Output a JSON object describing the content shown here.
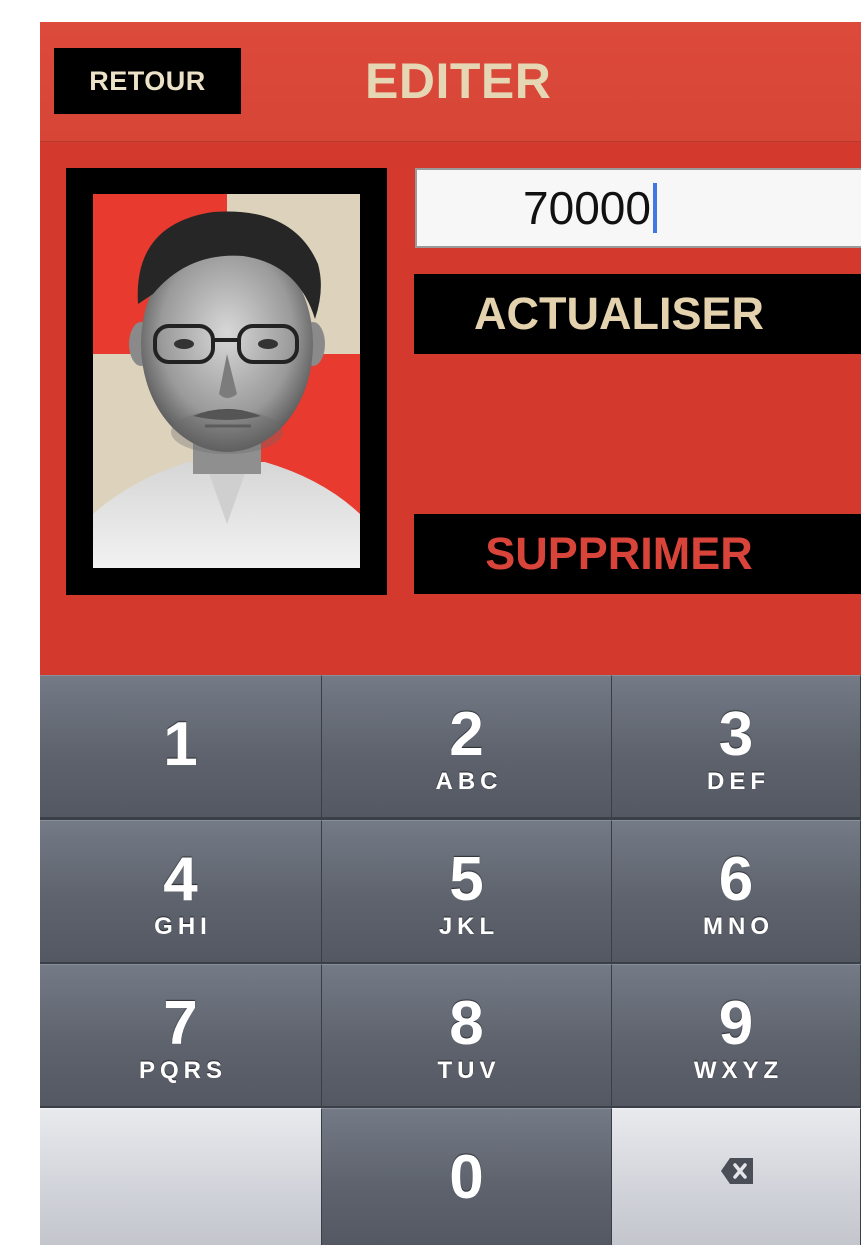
{
  "header": {
    "back_label": "RETOUR",
    "title": "EDITER"
  },
  "form": {
    "amount_value": "70000",
    "update_label": "ACTUALISER",
    "delete_label": "SUPPRIMER"
  },
  "keypad": {
    "keys": [
      {
        "digit": "1",
        "letters": ""
      },
      {
        "digit": "2",
        "letters": "ABC"
      },
      {
        "digit": "3",
        "letters": "DEF"
      },
      {
        "digit": "4",
        "letters": "GHI"
      },
      {
        "digit": "5",
        "letters": "JKL"
      },
      {
        "digit": "6",
        "letters": "MNO"
      },
      {
        "digit": "7",
        "letters": "PQRS"
      },
      {
        "digit": "8",
        "letters": "TUV"
      },
      {
        "digit": "9",
        "letters": "WXYZ"
      },
      {
        "digit": "0",
        "letters": ""
      }
    ],
    "backspace_icon": "backspace-icon"
  },
  "colors": {
    "background_red": "#d3392c",
    "accent_cream": "#e3d2ad",
    "delete_red": "#d8443a",
    "caret_blue": "#3f78e6"
  }
}
